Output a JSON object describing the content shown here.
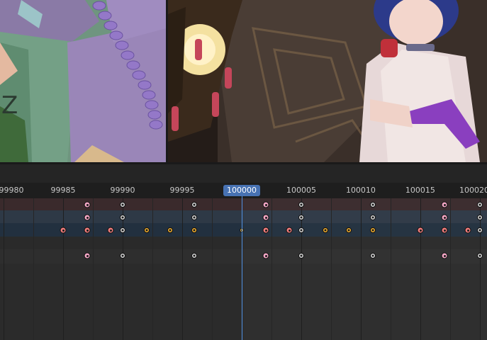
{
  "viewports": {
    "left": {
      "subject": "close-up of a character's braided hair and clothing in Blender viewport",
      "overlay_glyph": "Z"
    },
    "right": {
      "subject": "anime character in white dress under ornate ceiling lantern"
    }
  },
  "timeline": {
    "frame_labels": [
      "99980",
      "99985",
      "99990",
      "99995",
      "100005",
      "100010",
      "100015",
      "100020"
    ],
    "current_frame": "100000",
    "frames_visible": {
      "start": 99979.7,
      "end": 100020.6
    },
    "channels": [
      {
        "name": "row1",
        "color": "#3a2a2c"
      },
      {
        "name": "row2",
        "color": "#2e3946"
      },
      {
        "name": "row3",
        "color": "#22303f"
      },
      {
        "name": "row4",
        "color": "#2a2a2a"
      },
      {
        "name": "row5",
        "color": "#2e2e2e"
      }
    ],
    "keyframes": [
      {
        "row": 1,
        "frame": 99987,
        "type": "pink"
      },
      {
        "row": 1,
        "frame": 99990,
        "type": "white"
      },
      {
        "row": 1,
        "frame": 99996,
        "type": "white"
      },
      {
        "row": 1,
        "frame": 100002,
        "type": "pink"
      },
      {
        "row": 1,
        "frame": 100005,
        "type": "white"
      },
      {
        "row": 1,
        "frame": 100011,
        "type": "white"
      },
      {
        "row": 1,
        "frame": 100017,
        "type": "pink"
      },
      {
        "row": 1,
        "frame": 100020,
        "type": "white"
      },
      {
        "row": 2,
        "frame": 99987,
        "type": "pink"
      },
      {
        "row": 2,
        "frame": 99990,
        "type": "white"
      },
      {
        "row": 2,
        "frame": 99996,
        "type": "white"
      },
      {
        "row": 2,
        "frame": 100002,
        "type": "pink"
      },
      {
        "row": 2,
        "frame": 100005,
        "type": "white"
      },
      {
        "row": 2,
        "frame": 100011,
        "type": "white"
      },
      {
        "row": 2,
        "frame": 100017,
        "type": "pink"
      },
      {
        "row": 2,
        "frame": 100020,
        "type": "white"
      },
      {
        "row": 3,
        "frame": 99985,
        "type": "red"
      },
      {
        "row": 3,
        "frame": 99987,
        "type": "red"
      },
      {
        "row": 3,
        "frame": 99989,
        "type": "red"
      },
      {
        "row": 3,
        "frame": 99990,
        "type": "white"
      },
      {
        "row": 3,
        "frame": 99992,
        "type": "yellow"
      },
      {
        "row": 3,
        "frame": 99994,
        "type": "yellow"
      },
      {
        "row": 3,
        "frame": 99996,
        "type": "yellow"
      },
      {
        "row": 3,
        "frame": 100000,
        "type": "tiny"
      },
      {
        "row": 3,
        "frame": 100002,
        "type": "red"
      },
      {
        "row": 3,
        "frame": 100004,
        "type": "red"
      },
      {
        "row": 3,
        "frame": 100005,
        "type": "white"
      },
      {
        "row": 3,
        "frame": 100007,
        "type": "yellow"
      },
      {
        "row": 3,
        "frame": 100009,
        "type": "yellow"
      },
      {
        "row": 3,
        "frame": 100011,
        "type": "yellow"
      },
      {
        "row": 3,
        "frame": 100015,
        "type": "red"
      },
      {
        "row": 3,
        "frame": 100017,
        "type": "red"
      },
      {
        "row": 3,
        "frame": 100019,
        "type": "red"
      },
      {
        "row": 3,
        "frame": 100020,
        "type": "white"
      },
      {
        "row": 5,
        "frame": 99987,
        "type": "pink"
      },
      {
        "row": 5,
        "frame": 99990,
        "type": "white"
      },
      {
        "row": 5,
        "frame": 99996,
        "type": "white"
      },
      {
        "row": 5,
        "frame": 100002,
        "type": "pink"
      },
      {
        "row": 5,
        "frame": 100005,
        "type": "white"
      },
      {
        "row": 5,
        "frame": 100011,
        "type": "white"
      },
      {
        "row": 5,
        "frame": 100017,
        "type": "pink"
      },
      {
        "row": 5,
        "frame": 100020,
        "type": "white"
      }
    ]
  },
  "colors": {
    "playhead": "#4f8fe0",
    "current_frame_badge": "#4772b3"
  }
}
